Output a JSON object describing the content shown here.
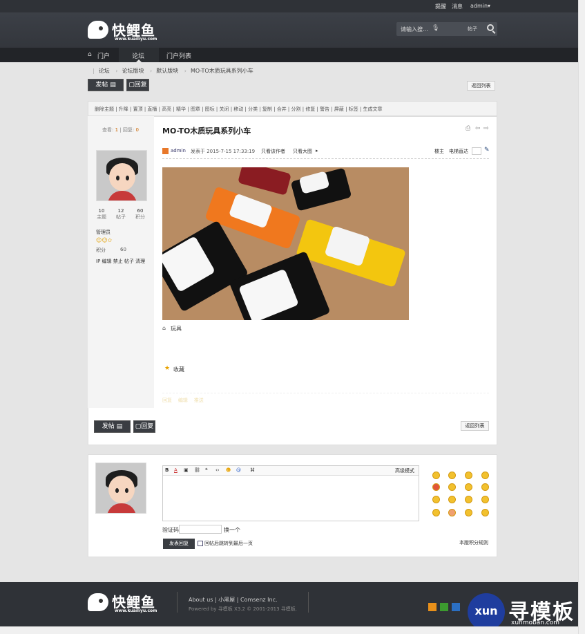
{
  "topbar": {
    "remind": "提醒",
    "message": "消息",
    "user": "admin",
    "caret": "▾"
  },
  "brand": {
    "name": "快鲤鱼",
    "url": "www.kuailiyu.com"
  },
  "search": {
    "placeholder": "请输入搜...",
    "type": "帖子"
  },
  "nav": {
    "home": "门户",
    "forum": "论坛",
    "portal_list": "门户列表"
  },
  "breadcrumbs": [
    "论坛",
    "论坛版块",
    "默认版块",
    "MO-TO木质玩具系列小车"
  ],
  "actions": {
    "new_post": "发帖",
    "reply": "回复",
    "back_list": "返回列表"
  },
  "mod_tools": "删除主题 | 升降 | 置顶 | 直播 | 高亮 | 精华 | 图章 | 图标 | 关闭 | 移动 | 分类 | 复制 | 合并 | 分割 | 修复 | 警告 | 屏蔽 | 标签 | 生成文章",
  "stats": {
    "views_label": "查看:",
    "views": "1",
    "replies_label": "回复:",
    "replies": "0"
  },
  "author": {
    "topics": "10",
    "topics_label": "主题",
    "posts": "12",
    "posts_label": "帖子",
    "points": "60",
    "points_label": "积分",
    "group": "管理员",
    "score_label": "积分",
    "score": "60",
    "links": "IP 编辑 禁止 帖子 清理"
  },
  "post": {
    "title": "MO-TO木质玩具系列小车",
    "author": "admin",
    "meta": "发表于 2015-7-15 17:33:19",
    "only_author": "只看该作者",
    "only_big": "只看大图",
    "floor": "楼主",
    "teleport": "电梯直达",
    "tag": "玩具",
    "favorite": "收藏",
    "reply_action": "回复",
    "edit_action": "编辑",
    "recommend_action": "推送"
  },
  "editor": {
    "advanced": "高级模式",
    "captcha_label": "验证码",
    "captcha_refresh": "换一个",
    "submit": "发表回复",
    "jump_label": "回帖后跳转到最后一页",
    "rules": "本版积分规则"
  },
  "footer": {
    "links": "About us | 小黑屋 | Comsenz Inc.",
    "powered": "Powered by 寻模板 X3.2 © 2001-2013 寻模板."
  },
  "watermark": {
    "circle": "xun",
    "text": "寻模板",
    "url": "xunmoban.com"
  }
}
